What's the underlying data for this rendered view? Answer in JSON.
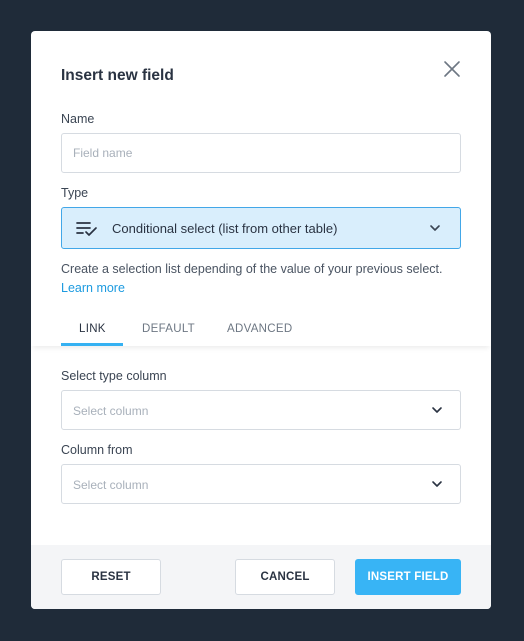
{
  "modal": {
    "title": "Insert new field"
  },
  "name_field": {
    "label": "Name",
    "placeholder": "Field name",
    "value": ""
  },
  "type_field": {
    "label": "Type",
    "value": "Conditional select (list from other table)",
    "icon": "list-check-icon"
  },
  "description": {
    "text": "Create a selection list depending of the value of your previous select.",
    "link_text": "Learn more"
  },
  "tabs": [
    {
      "label": "LINK",
      "active": true
    },
    {
      "label": "DEFAULT",
      "active": false
    },
    {
      "label": "ADVANCED",
      "active": false
    }
  ],
  "select_type_column": {
    "label": "Select type column",
    "placeholder": "Select column"
  },
  "column_from": {
    "label": "Column from",
    "placeholder": "Select column"
  },
  "footer": {
    "reset_label": "RESET",
    "cancel_label": "CANCEL",
    "insert_label": "INSERT FIELD"
  },
  "colors": {
    "backdrop": "#1f2b39",
    "accent": "#38b4f5",
    "selected_bg": "#d9eefc",
    "link": "#1d9be0"
  }
}
